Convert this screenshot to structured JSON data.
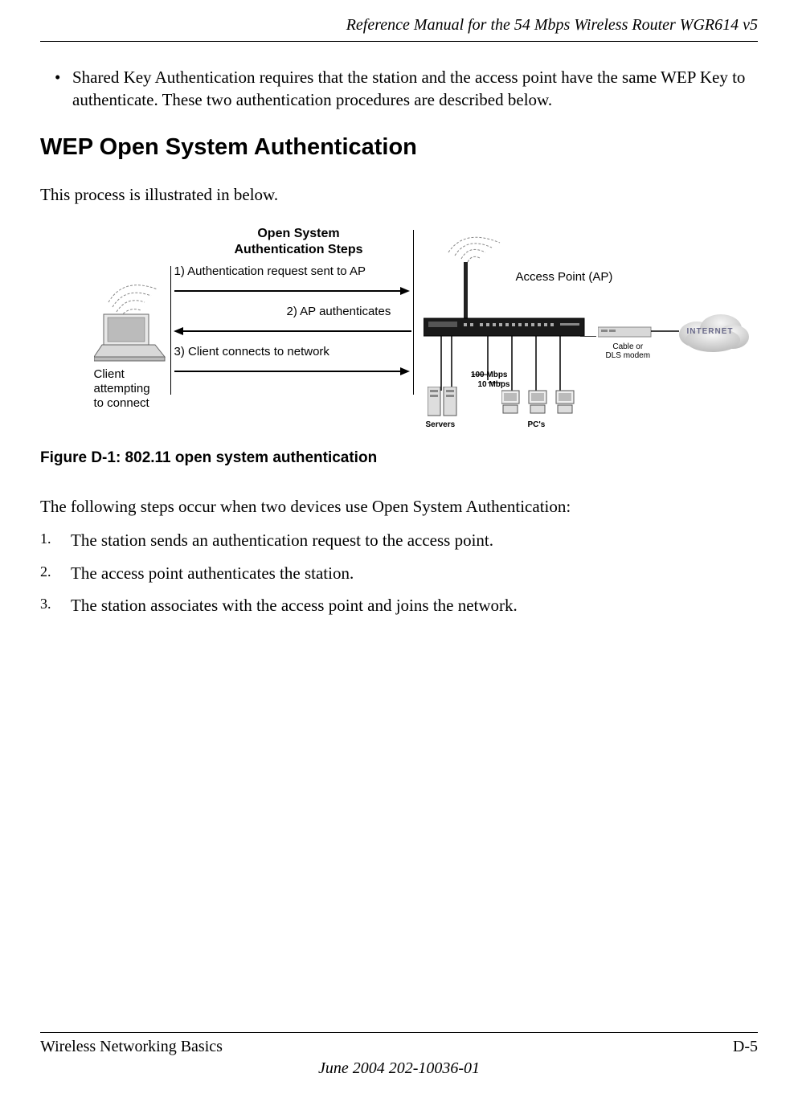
{
  "header": {
    "manual_title": "Reference Manual for the 54 Mbps Wireless Router WGR614 v5"
  },
  "bullet": {
    "marker": "•",
    "text": "Shared Key Authentication requires that the station and the access point have the same WEP Key to authenticate. These two authentication procedures are described below."
  },
  "section_heading": "WEP Open System Authentication",
  "intro_text": "This process is illustrated in below.",
  "figure": {
    "title_line1": "Open System",
    "title_line2": "Authentication Steps",
    "step1": "1) Authentication request sent to AP",
    "step2": "2) AP authenticates",
    "step3": "3) Client connects to network",
    "client_label_line1": "Client",
    "client_label_line2": "attempting",
    "client_label_line3": "to connect",
    "ap_label": "Access Point (AP)",
    "modem_label_line1": "Cable or",
    "modem_label_line2": "DLS modem",
    "internet_label": "INTERNET",
    "speed_100": "100 Mbps",
    "speed_10": "10 Mbps",
    "servers_label": "Servers",
    "pcs_label": "PC's",
    "caption": "Figure D-1:  802.11 open system authentication"
  },
  "following_text": "The following steps occur when two devices use Open System Authentication:",
  "steps": [
    {
      "num": "1.",
      "text": "The station sends an authentication request to the access point."
    },
    {
      "num": "2.",
      "text": "The access point authenticates the station."
    },
    {
      "num": "3.",
      "text": "The station associates with the access point and joins the network."
    }
  ],
  "footer": {
    "left": "Wireless Networking Basics",
    "right": "D-5",
    "date": "June 2004 202-10036-01"
  }
}
